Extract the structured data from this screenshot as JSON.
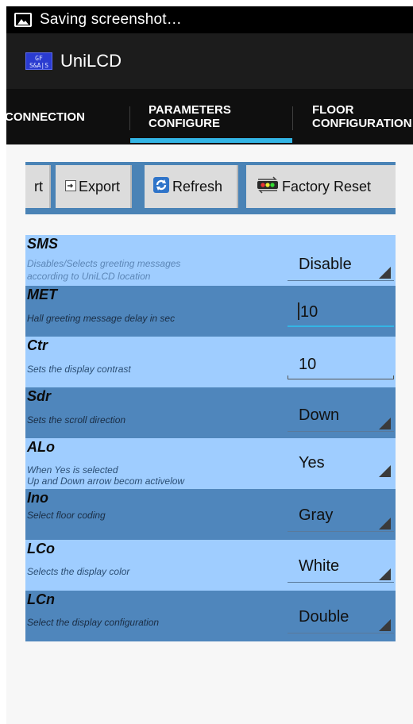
{
  "status_bar": {
    "text": "Saving screenshot…"
  },
  "app": {
    "title": "UniLCD",
    "icon_text": "GF S&A|S"
  },
  "tabs": [
    {
      "label": "CONNECTION",
      "selected": false
    },
    {
      "label_line1": "PARAMETERS",
      "label_line2": "CONFIGURE",
      "selected": true
    },
    {
      "label_line1": "FLOOR",
      "label_line2": "CONFIGURATION",
      "selected": false
    }
  ],
  "toolbar": {
    "import_label": "rt",
    "export_label": "Export",
    "refresh_label": "Refresh",
    "factory_reset_label": "Factory Reset"
  },
  "parameters": [
    {
      "name": "SMS",
      "desc1": "Disables/Selects greeting messages",
      "desc2": "according to UniLCD location",
      "value": "Disable",
      "control": "spinner"
    },
    {
      "name": "MET",
      "desc1": "Hall greeting message delay in sec",
      "value": "10",
      "control": "edit",
      "focused": true
    },
    {
      "name": "Ctr",
      "desc1": "Sets the display contrast",
      "value": "10",
      "control": "edit"
    },
    {
      "name": "Sdr",
      "desc1": "Sets the scroll direction",
      "value": "Down",
      "control": "spinner"
    },
    {
      "name": "ALo",
      "desc1": "When Yes is selected",
      "desc2": " Up and Down arrow becom activelow",
      "value": "Yes",
      "control": "spinner"
    },
    {
      "name": "Ino",
      "desc1": "Select floor coding",
      "value": "Gray",
      "control": "spinner"
    },
    {
      "name": "LCo",
      "desc1": "Selects the display color",
      "value": "White",
      "control": "spinner"
    },
    {
      "name": "LCn",
      "desc1": "Select the display configuration",
      "value": "Double",
      "control": "spinner"
    }
  ],
  "colors": {
    "accent": "#33b5e5",
    "row_light": "#9fcdff",
    "row_dark": "#4f86bc",
    "toolbar_bg": "#4a83b6"
  }
}
